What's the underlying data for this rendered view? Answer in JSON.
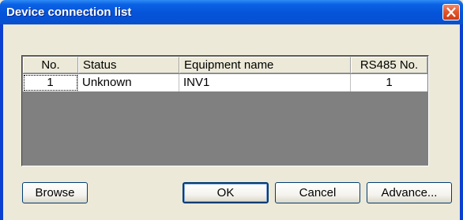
{
  "window": {
    "title": "Device connection list"
  },
  "table": {
    "columns": [
      "No.",
      "Status",
      "Equipment name",
      "RS485 No."
    ],
    "rows": [
      {
        "no": "1",
        "status": "Unknown",
        "equipment_name": "INV1",
        "rs485_no": "1"
      }
    ]
  },
  "buttons": {
    "browse": "Browse",
    "ok": "OK",
    "cancel": "Cancel",
    "advance": "Advance..."
  },
  "colors": {
    "titlebar": "#0553d8",
    "close": "#e2582f",
    "grid_empty": "#808080",
    "dialog_bg": "#ece9d8"
  }
}
